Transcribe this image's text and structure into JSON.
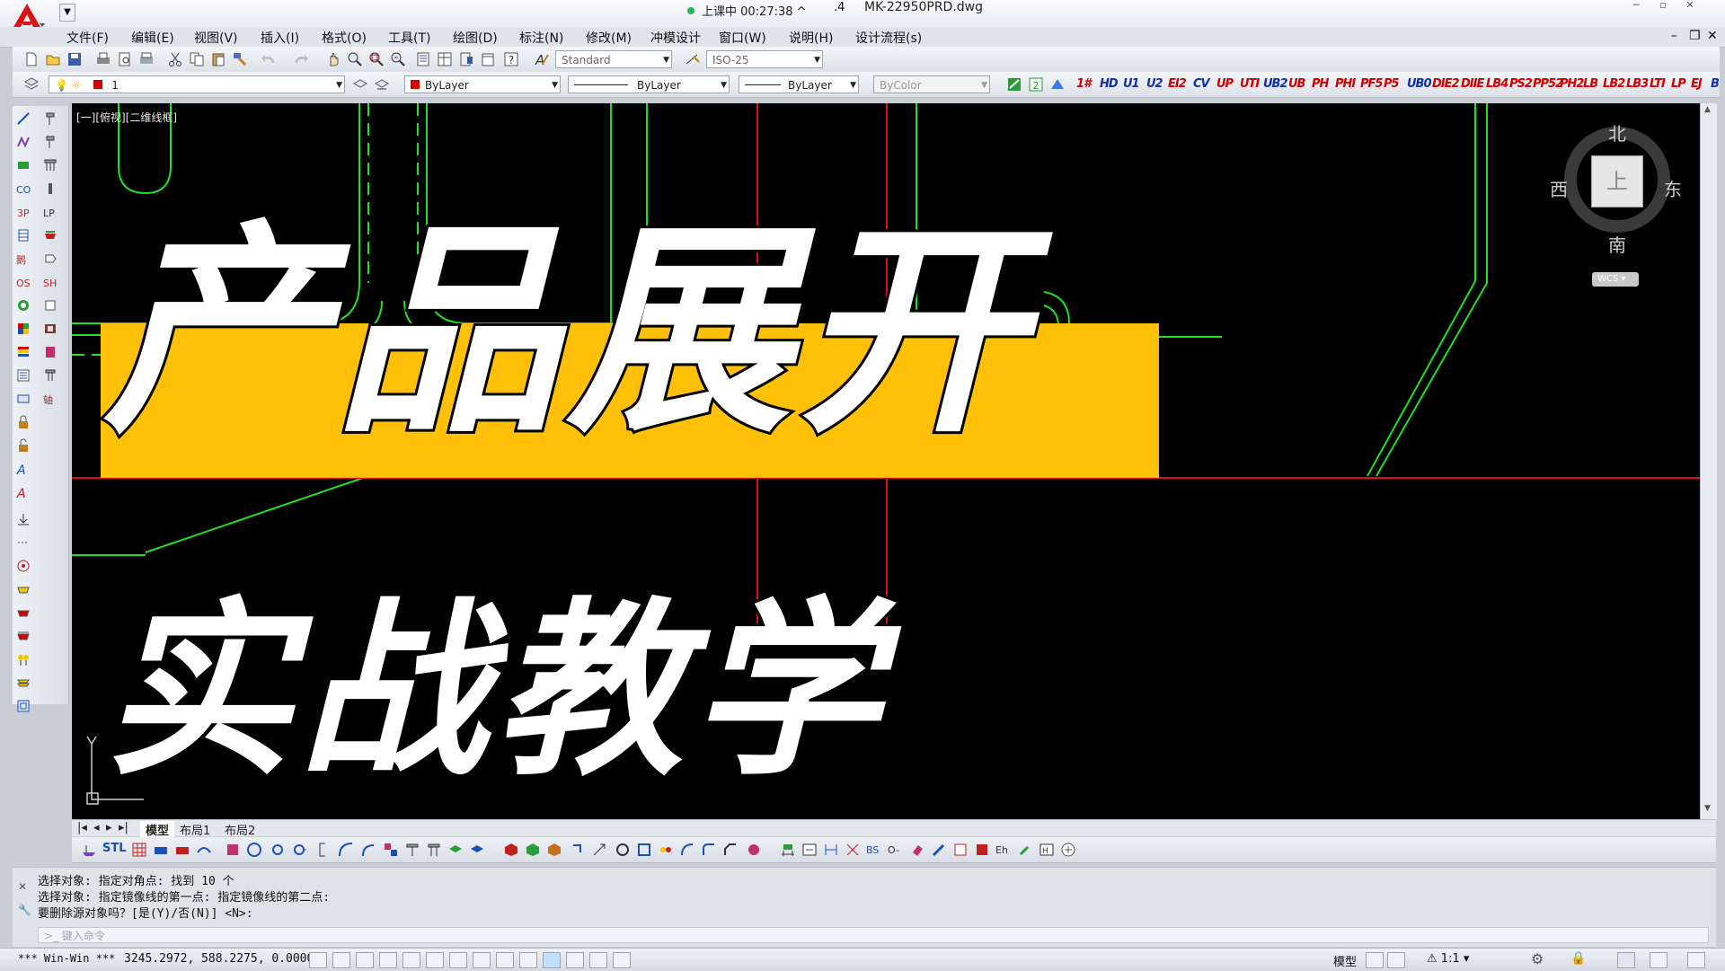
{
  "titlebar": {
    "rec_status": "上课中 00:27:38",
    "sep": ".4",
    "file_name": "MK-22950PRD.dwg"
  },
  "menus": [
    "文件(F)",
    "编辑(E)",
    "视图(V)",
    "插入(I)",
    "格式(O)",
    "工具(T)",
    "绘图(D)",
    "标注(N)",
    "修改(M)",
    "冲模设计",
    "窗口(W)",
    "说明(H)",
    "设计流程(s)"
  ],
  "toolbar1": {
    "text_style": "Standard",
    "dim_style": "ISO-25"
  },
  "toolbar2": {
    "layer": "1",
    "color": "ByLayer",
    "linetype": "ByLayer",
    "lineweight": "ByLayer",
    "plotstyle": "ByColor",
    "custom_tools": [
      "1#",
      "HD",
      "U1",
      "U2",
      "EI2",
      "CV",
      "UP",
      "UTI",
      "UB2",
      "UB",
      "PH",
      "PHI",
      "PF5",
      "P5",
      "UB0",
      "DIE2",
      "DIIE",
      "LB4",
      "PS2",
      "PP52",
      "PH2",
      "LB",
      "LB2",
      "LB3",
      "LTI",
      "LP",
      "EJ",
      "B"
    ]
  },
  "viewport_label": "[一][俯视][二维线框]",
  "overlay": {
    "line1": "产品展开",
    "line2": "实战教学"
  },
  "viewcube": {
    "north": "北",
    "south": "南",
    "east": "东",
    "west": "西",
    "face": "上",
    "wcs": "WCS"
  },
  "tabs": [
    "模型",
    "布局1",
    "布局2"
  ],
  "command_history": [
    "选择对象: 指定对角点: 找到 10 个",
    "选择对象:  指定镜像线的第一点: 指定镜像线的第二点:",
    "要删除源对象吗？[是(Y)/否(N)] <N>:"
  ],
  "command_input_placeholder": "键入命令",
  "statusbar": {
    "profile": "*** Win-Win ***",
    "coords": "3245.2972, 588.2275, 0.0000",
    "model": "模型",
    "scale": "1:1"
  },
  "colors": {
    "canvas": "#000000",
    "band": "#ffc107",
    "green_geom": "#20e020",
    "red_axis": "#e01010"
  }
}
